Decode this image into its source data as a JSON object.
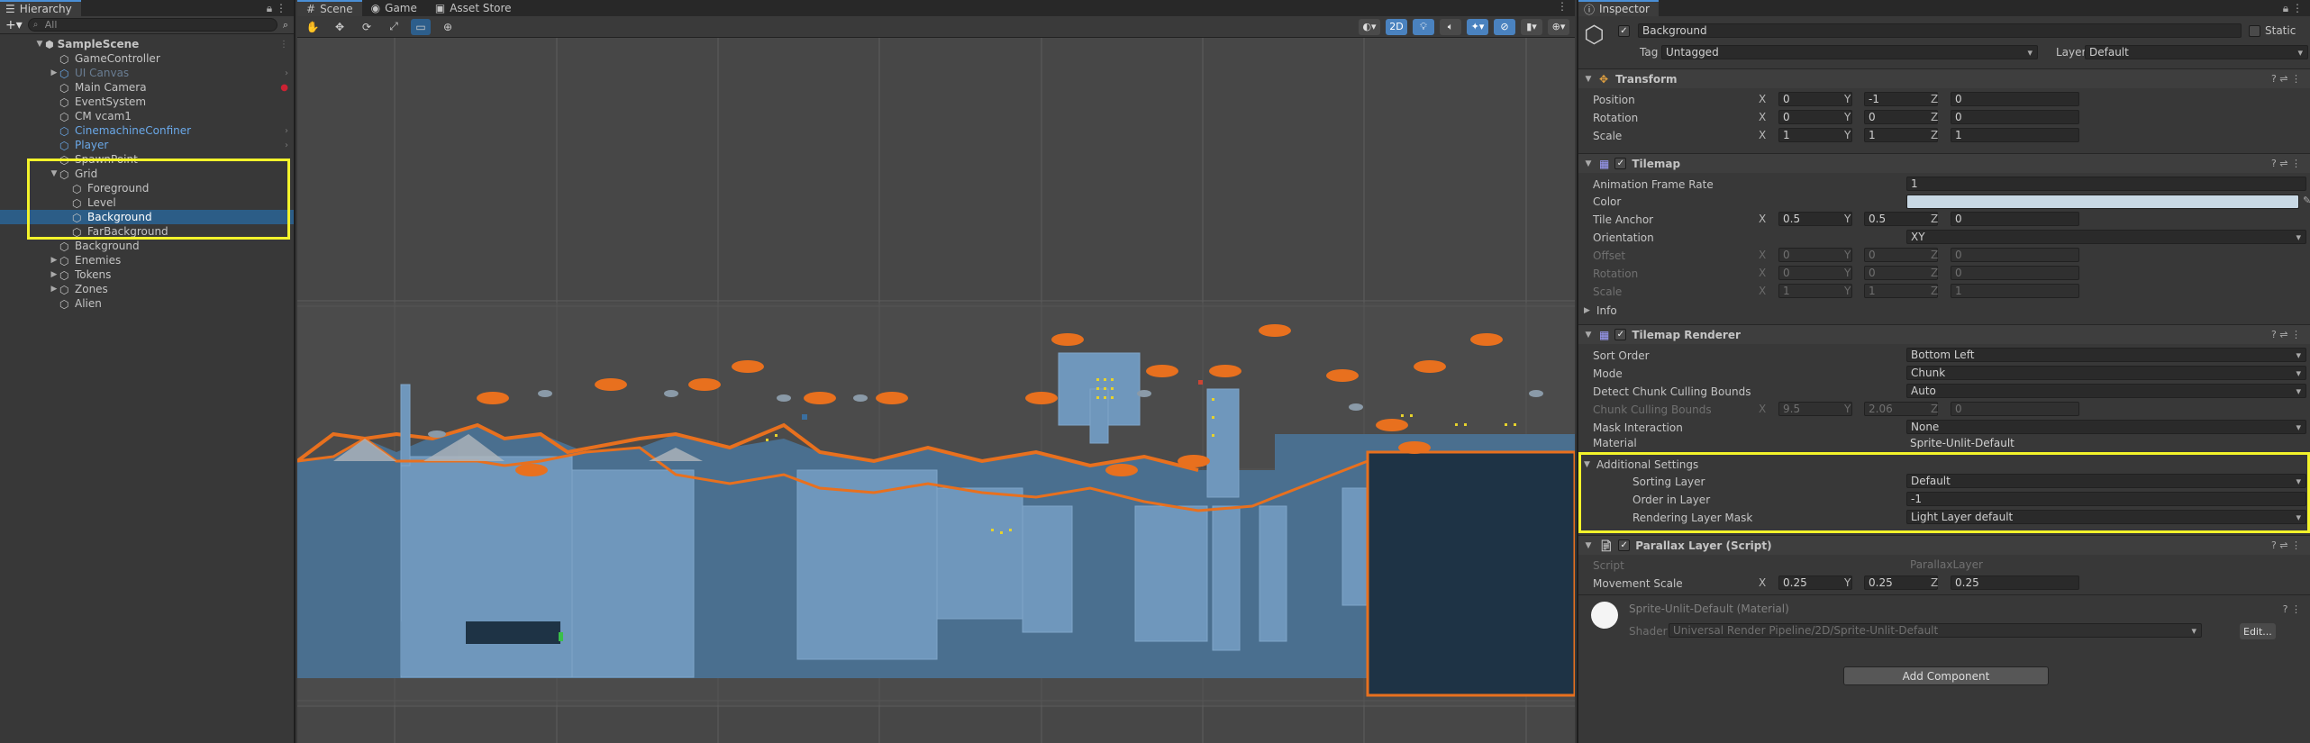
{
  "hierarchy": {
    "tab_label": "Hierarchy",
    "search_placeholder": "All",
    "scene_name": "SampleScene",
    "items": [
      {
        "label": "GameController"
      },
      {
        "label": "UI Canvas"
      },
      {
        "label": "Main Camera"
      },
      {
        "label": "EventSystem"
      },
      {
        "label": "CM vcam1"
      },
      {
        "label": "CinemachineConfiner"
      },
      {
        "label": "Player"
      },
      {
        "label": "SpawnPoint"
      },
      {
        "label": "Grid"
      },
      {
        "label": "Foreground"
      },
      {
        "label": "Level"
      },
      {
        "label": "Background"
      },
      {
        "label": "FarBackground"
      },
      {
        "label": "Background"
      },
      {
        "label": "Enemies"
      },
      {
        "label": "Tokens"
      },
      {
        "label": "Zones"
      },
      {
        "label": "Alien"
      }
    ]
  },
  "scene": {
    "tabs": [
      "Scene",
      "Game",
      "Asset Store"
    ],
    "mode_2d": "2D"
  },
  "inspector": {
    "tab_label": "Inspector",
    "object_name": "Background",
    "static_label": "Static",
    "tag_label": "Tag",
    "tag_value": "Untagged",
    "layer_label": "Layer",
    "layer_value": "Default",
    "transform": {
      "title": "Transform",
      "position_label": "Position",
      "position": [
        "0",
        "-1",
        "0"
      ],
      "rotation_label": "Rotation",
      "rotation": [
        "0",
        "0",
        "0"
      ],
      "scale_label": "Scale",
      "scale": [
        "1",
        "1",
        "1"
      ]
    },
    "tilemap": {
      "title": "Tilemap",
      "frame_rate_label": "Animation Frame Rate",
      "frame_rate": "1",
      "color_label": "Color",
      "color_value": "#c8d8e4",
      "anchor_label": "Tile Anchor",
      "anchor": [
        "0.5",
        "0.5",
        "0"
      ],
      "orientation_label": "Orientation",
      "orientation": "XY",
      "offset_label": "Offset",
      "offset": [
        "0",
        "0",
        "0"
      ],
      "rotation_label": "Rotation",
      "rotation": [
        "0",
        "0",
        "0"
      ],
      "scale_label": "Scale",
      "scale": [
        "1",
        "1",
        "1"
      ],
      "info_label": "Info"
    },
    "renderer": {
      "title": "Tilemap Renderer",
      "sort_order_label": "Sort Order",
      "sort_order": "Bottom Left",
      "mode_label": "Mode",
      "mode": "Chunk",
      "detect_label": "Detect Chunk Culling Bounds",
      "detect": "Auto",
      "bounds_label": "Chunk Culling Bounds",
      "bounds": [
        "9.5",
        "2.06",
        "0"
      ],
      "mask_label": "Mask Interaction",
      "mask": "None",
      "material_label": "Material",
      "material": "Sprite-Unlit-Default"
    },
    "additional": {
      "title": "Additional Settings",
      "sorting_layer_label": "Sorting Layer",
      "sorting_layer": "Default",
      "order_label": "Order in Layer",
      "order": "-1",
      "rendering_mask_label": "Rendering Layer Mask",
      "rendering_mask": "Light Layer default"
    },
    "parallax": {
      "title": "Parallax Layer (Script)",
      "script_label": "Script",
      "script": "ParallaxLayer",
      "movement_label": "Movement Scale",
      "movement": [
        "0.25",
        "0.25",
        "0.25"
      ]
    },
    "material": {
      "name": "Sprite-Unlit-Default (Material)",
      "shader_label": "Shader",
      "shader": "Universal Render Pipeline/2D/Sprite-Unlit-Default",
      "edit_label": "Edit..."
    },
    "add_component": "Add Component"
  },
  "colors": {
    "highlight": "#f3f32b",
    "selection": "#2c5d87",
    "orange": "#e8701e",
    "level_blue": "#7fa6c8"
  }
}
